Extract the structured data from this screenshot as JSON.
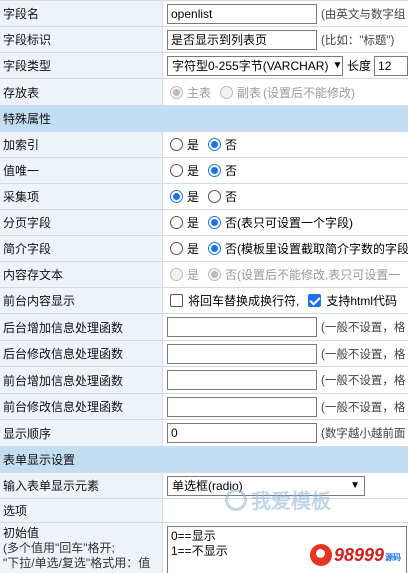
{
  "rows": {
    "field_name": {
      "label": "字段名",
      "value": "openlist",
      "hint": "(由英文与数字组"
    },
    "field_id": {
      "label": "字段标识",
      "value": "是否显示到列表页",
      "hint": "(比如：\"标题\")"
    },
    "field_type": {
      "label": "字段类型",
      "select": "字符型0-255字节(VARCHAR)",
      "length_label": "长度",
      "length_value": "12"
    },
    "table": {
      "label": "存放表",
      "opt1": "主表",
      "opt2": "副表",
      "hint": "(设置后不能修改)"
    }
  },
  "sections": {
    "special": "特殊属性",
    "form": "表单显示设置"
  },
  "special": {
    "index": {
      "label": "加索引",
      "yes": "是",
      "no": "否"
    },
    "unique": {
      "label": "值唯一",
      "yes": "是",
      "no": "否"
    },
    "collect": {
      "label": "采集项",
      "yes": "是",
      "no": "否"
    },
    "page": {
      "label": "分页字段",
      "yes": "是",
      "no": "否(表只可设置一个字段)"
    },
    "intro": {
      "label": "简介字段",
      "yes": "是",
      "no": "否(模板里设置截取简介字数的字段"
    },
    "content": {
      "label": "内容存文本",
      "yes": "是",
      "no": "否(设置后不能修改,表只可设置一"
    },
    "frontdisplay": {
      "label": "前台内容显示",
      "opt1": "将回车替换成换行符,",
      "opt2": "支持html代码"
    },
    "back_add": {
      "label": "后台增加信息处理函数",
      "hint": "(一般不设置，格"
    },
    "back_edit": {
      "label": "后台修改信息处理函数",
      "hint": "(一般不设置，格"
    },
    "front_add": {
      "label": "前台增加信息处理函数",
      "hint": "(一般不设置，格"
    },
    "front_edit": {
      "label": "前台修改信息处理函数",
      "hint": "(一般不设置，格"
    },
    "order": {
      "label": "显示顺序",
      "value": "0",
      "hint": "(数字越小越前面"
    }
  },
  "form": {
    "input_element": {
      "label": "输入表单显示元素",
      "select": "单选框(radio)"
    },
    "options": {
      "label": "选项"
    },
    "initial": {
      "label": "初始值",
      "note1": "(多个值用\"回车\"格开;",
      "note2": "\"下拉/单选/复选\"格式用：值",
      "value": "0==显示\n1==不显示"
    }
  },
  "watermark": {
    "text": "我爱模板"
  },
  "logo": {
    "text": "98999",
    "sub": "源码"
  },
  "colors": {
    "label_bg": "#edf3f9",
    "section_bg": "#c3ddf2",
    "accent": "#1a73e8",
    "border": "#cfdbe8"
  }
}
